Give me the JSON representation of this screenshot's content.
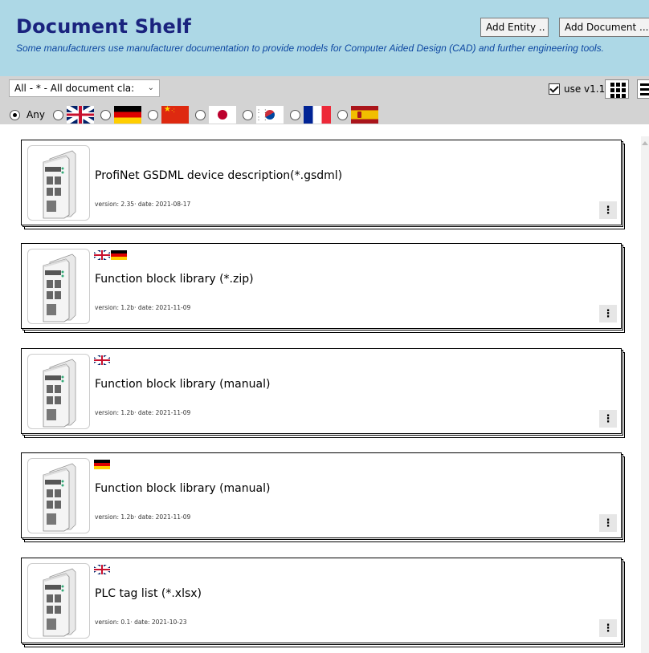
{
  "header": {
    "title": "Document Shelf",
    "subtitle": "Some manufacturers use manufacturer documentation to provide models for Computer Aided Design (CAD) and further engineering tools.",
    "add_entity_label": "Add Entity ..",
    "add_document_label": "Add Document ..."
  },
  "toolbar": {
    "document_class_select": "All - * - All document cla:",
    "use_version_label": "use v1.1",
    "use_version_checked": true,
    "language_any_label": "Any",
    "languages": [
      "gb",
      "de",
      "cn",
      "jp",
      "kr",
      "fr",
      "es"
    ],
    "selected_language": "Any"
  },
  "documents": [
    {
      "title": "ProfiNet GSDML device description(*.gsdml)",
      "meta": "version: 2.35· date: 2021-08-17",
      "flags": []
    },
    {
      "title": "Function block library (*.zip)",
      "meta": "version: 1.2b· date: 2021-11-09",
      "flags": [
        "gb",
        "de"
      ]
    },
    {
      "title": "Function block library (manual)",
      "meta": "version: 1.2b· date: 2021-11-09",
      "flags": [
        "gb"
      ]
    },
    {
      "title": "Function block library (manual)",
      "meta": "version: 1.2b· date: 2021-11-09",
      "flags": [
        "de"
      ]
    },
    {
      "title": "PLC tag list (*.xlsx)",
      "meta": "version: 0.1· date: 2021-10-23",
      "flags": [
        "gb"
      ]
    }
  ],
  "icons": {
    "kebab": "more-vertical-icon",
    "grid_view": "grid-view-icon",
    "list_view": "list-view-icon",
    "dropdown": "chevron-down-icon"
  }
}
